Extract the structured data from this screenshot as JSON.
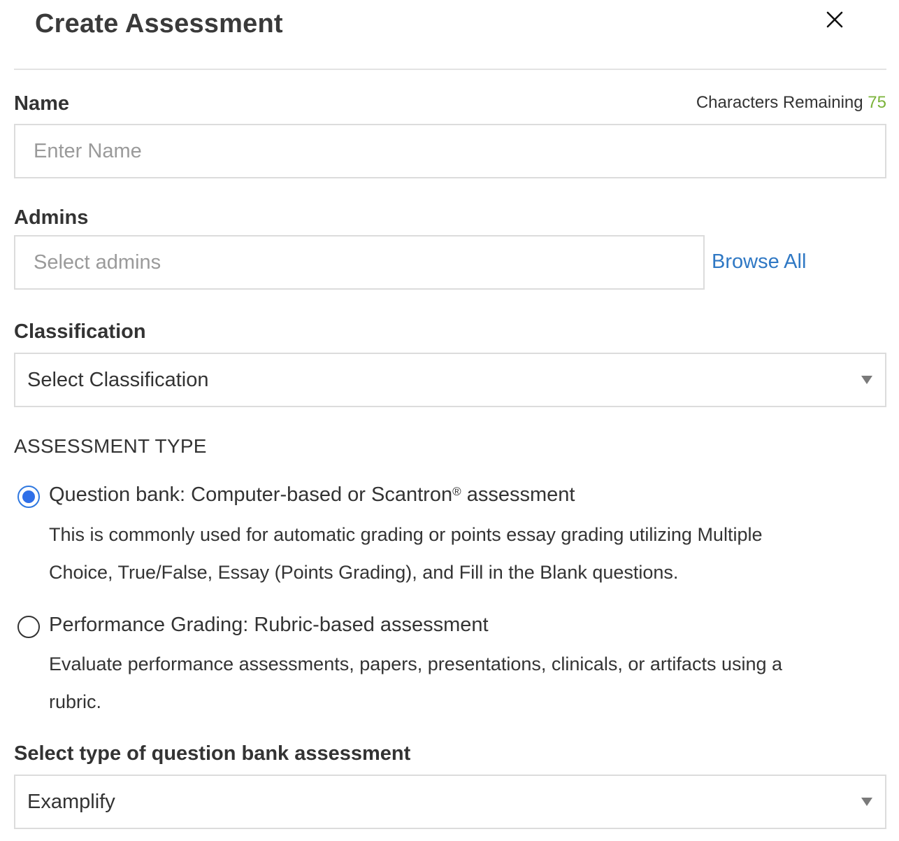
{
  "dialog": {
    "title": "Create Assessment",
    "close_icon": "close-icon"
  },
  "name_field": {
    "label": "Name",
    "counter_label": "Characters Remaining",
    "counter_value": "75",
    "placeholder": "Enter Name",
    "value": ""
  },
  "admins_field": {
    "label": "Admins",
    "placeholder": "Select admins",
    "browse_label": "Browse All"
  },
  "classification": {
    "label": "Classification",
    "selected": "Select Classification"
  },
  "assessment_type": {
    "heading": "ASSESSMENT TYPE",
    "options": [
      {
        "title_main": "Question bank: Computer-based or Scantron",
        "title_mark": "®",
        "title_end": " assessment",
        "desc_line1": "This is commonly used for automatic grading or points essay grading utilizing Multiple",
        "desc_line2": "Choice, True/False, Essay (Points Grading), and Fill in the Blank questions.",
        "checked": true
      },
      {
        "title": "Performance Grading: Rubric-based assessment",
        "desc_line1": "Evaluate performance assessments, papers, presentations, clinicals, or artifacts using a",
        "desc_line2": "rubric.",
        "checked": false
      }
    ]
  },
  "question_bank_type": {
    "label": "Select type of question bank assessment",
    "selected": "Examplify"
  },
  "colors": {
    "accent": "#2f78c4",
    "radio_checked": "#2f6fe8",
    "counter_value": "#7bb33a",
    "border": "#dcdcdc"
  }
}
